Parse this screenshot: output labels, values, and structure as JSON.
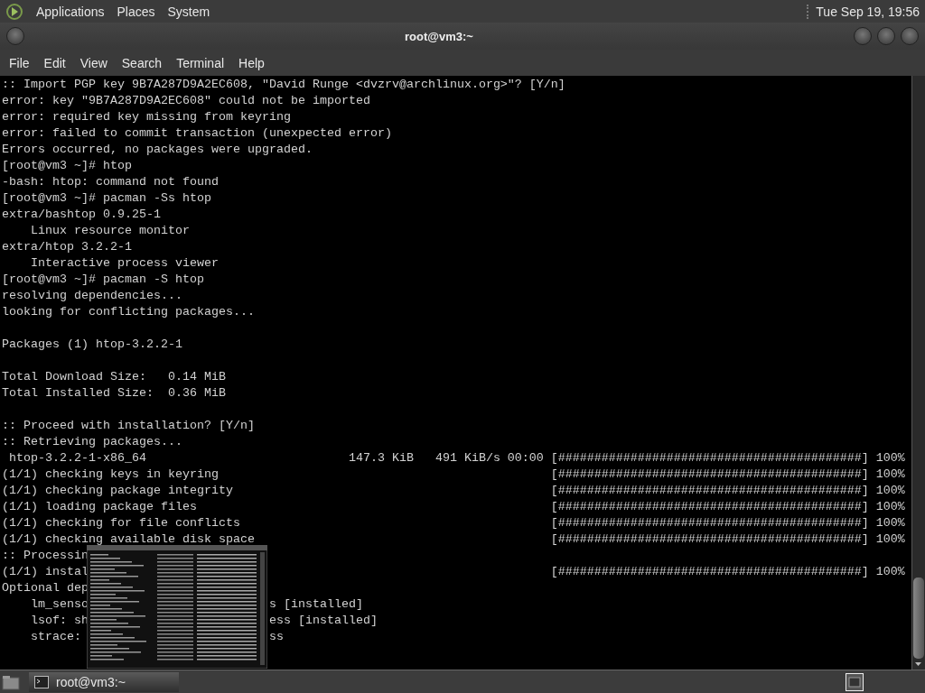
{
  "top_panel": {
    "menus": [
      "Applications",
      "Places",
      "System"
    ],
    "clock": "Tue Sep 19, 19:56"
  },
  "window": {
    "title": "root@vm3:~",
    "menu": [
      "File",
      "Edit",
      "View",
      "Search",
      "Terminal",
      "Help"
    ]
  },
  "terminal": {
    "lines": [
      {
        "kind": "plain",
        "text": ":: Import PGP key 9B7A287D9A2EC608, \"David Runge <dvzrv@archlinux.org>\"? [Y/n]"
      },
      {
        "kind": "plain",
        "text": "error: key \"9B7A287D9A2EC608\" could not be imported"
      },
      {
        "kind": "plain",
        "text": "error: required key missing from keyring"
      },
      {
        "kind": "plain",
        "text": "error: failed to commit transaction (unexpected error)"
      },
      {
        "kind": "plain",
        "text": "Errors occurred, no packages were upgraded."
      },
      {
        "kind": "plain",
        "text": "[root@vm3 ~]# htop"
      },
      {
        "kind": "plain",
        "text": "-bash: htop: command not found"
      },
      {
        "kind": "plain",
        "text": "[root@vm3 ~]# pacman -Ss htop"
      },
      {
        "kind": "plain",
        "text": "extra/bashtop 0.9.25-1"
      },
      {
        "kind": "plain",
        "text": "    Linux resource monitor"
      },
      {
        "kind": "plain",
        "text": "extra/htop 3.2.2-1"
      },
      {
        "kind": "plain",
        "text": "    Interactive process viewer"
      },
      {
        "kind": "plain",
        "text": "[root@vm3 ~]# pacman -S htop"
      },
      {
        "kind": "plain",
        "text": "resolving dependencies..."
      },
      {
        "kind": "plain",
        "text": "looking for conflicting packages..."
      },
      {
        "kind": "blank"
      },
      {
        "kind": "plain",
        "text": "Packages (1) htop-3.2.2-1"
      },
      {
        "kind": "blank"
      },
      {
        "kind": "plain",
        "text": "Total Download Size:   0.14 MiB"
      },
      {
        "kind": "plain",
        "text": "Total Installed Size:  0.36 MiB"
      },
      {
        "kind": "blank"
      },
      {
        "kind": "plain",
        "text": ":: Proceed with installation? [Y/n]"
      },
      {
        "kind": "plain",
        "text": ":: Retrieving packages..."
      },
      {
        "kind": "progress",
        "text": " htop-3.2.2-1-x86_64                            147.3 KiB   491 KiB/s 00:00",
        "bar": "[##########################################] 100%"
      },
      {
        "kind": "progress",
        "text": "(1/1) checking keys in keyring",
        "bar": "[##########################################] 100%"
      },
      {
        "kind": "progress",
        "text": "(1/1) checking package integrity",
        "bar": "[##########################################] 100%"
      },
      {
        "kind": "progress",
        "text": "(1/1) loading package files",
        "bar": "[##########################################] 100%"
      },
      {
        "kind": "progress",
        "text": "(1/1) checking for file conflicts",
        "bar": "[##########################################] 100%"
      },
      {
        "kind": "progress",
        "text": "(1/1) checking available disk space",
        "bar": "[##########################################] 100%"
      },
      {
        "kind": "plain",
        "text": ":: Processin"
      },
      {
        "kind": "progress",
        "text": "(1/1) instal",
        "bar": "[##########################################] 100%"
      },
      {
        "kind": "plain",
        "text": "Optional dep"
      },
      {
        "kind": "split",
        "text": "    lm_senso",
        "right": "s [installed]"
      },
      {
        "kind": "split",
        "text": "    lsof: sh",
        "right": "ess [installed]"
      },
      {
        "kind": "split",
        "text": "    strace:",
        "right": "ss"
      }
    ]
  },
  "taskbar": {
    "tasks": [
      {
        "label": "root@vm3:~",
        "selected": true
      }
    ]
  }
}
